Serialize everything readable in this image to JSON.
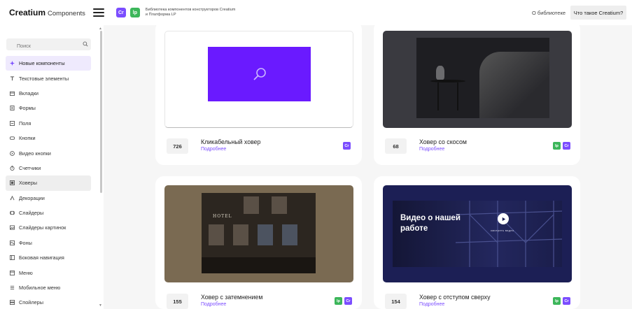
{
  "header": {
    "logo_main": "Creatium",
    "logo_sub": "Components",
    "badge_cr": "Cr",
    "badge_lp": "lp",
    "description": "Библиотека компонентов конструкторов Creatium и Платформа LP",
    "about_link": "О библиотеке",
    "what_button": "Что такое Creatium?"
  },
  "sidebar": {
    "search_placeholder": "Поиск",
    "items": [
      {
        "label": "Новые компоненты",
        "icon": "sparkle-icon"
      },
      {
        "label": "Текстовые элементы",
        "icon": "text-icon"
      },
      {
        "label": "Вкладки",
        "icon": "tabs-icon"
      },
      {
        "label": "Формы",
        "icon": "form-icon"
      },
      {
        "label": "Поля",
        "icon": "field-icon"
      },
      {
        "label": "Кнопки",
        "icon": "button-icon"
      },
      {
        "label": "Видео кнопки",
        "icon": "play-icon"
      },
      {
        "label": "Счетчики",
        "icon": "timer-icon"
      },
      {
        "label": "Ховеры",
        "icon": "hover-icon"
      },
      {
        "label": "Декорации",
        "icon": "decoration-icon"
      },
      {
        "label": "Слайдеры",
        "icon": "slider-icon"
      },
      {
        "label": "Слайдеры картинок",
        "icon": "image-slider-icon"
      },
      {
        "label": "Фоны",
        "icon": "background-icon"
      },
      {
        "label": "Боковая навигация",
        "icon": "side-nav-icon"
      },
      {
        "label": "Меню",
        "icon": "menu-icon"
      },
      {
        "label": "Мобильное меню",
        "icon": "mobile-menu-icon"
      },
      {
        "label": "Спойлеры",
        "icon": "spoiler-icon"
      }
    ]
  },
  "cards": [
    {
      "count": "726",
      "title": "Кликабельный ховер",
      "more": "Подробнее",
      "badges": [
        "Cr"
      ]
    },
    {
      "count": "68",
      "title": "Ховер со скосом",
      "more": "Подробнее",
      "badges": [
        "lp",
        "Cr"
      ]
    },
    {
      "count": "155",
      "title": "Ховер с затемнением",
      "more": "Подробнее",
      "badges": [
        "lp",
        "Cr"
      ],
      "image_text": "HOTEL"
    },
    {
      "count": "154",
      "title": "Ховер с отступом сверху",
      "more": "Подробнее",
      "badges": [
        "lp",
        "Cr"
      ],
      "video_title": "Видео о нашей работе",
      "video_button": "смотреть видео"
    }
  ],
  "colors": {
    "accent": "#7b4dff",
    "lp_green": "#3cb65a",
    "active_bg": "#efeafd"
  }
}
